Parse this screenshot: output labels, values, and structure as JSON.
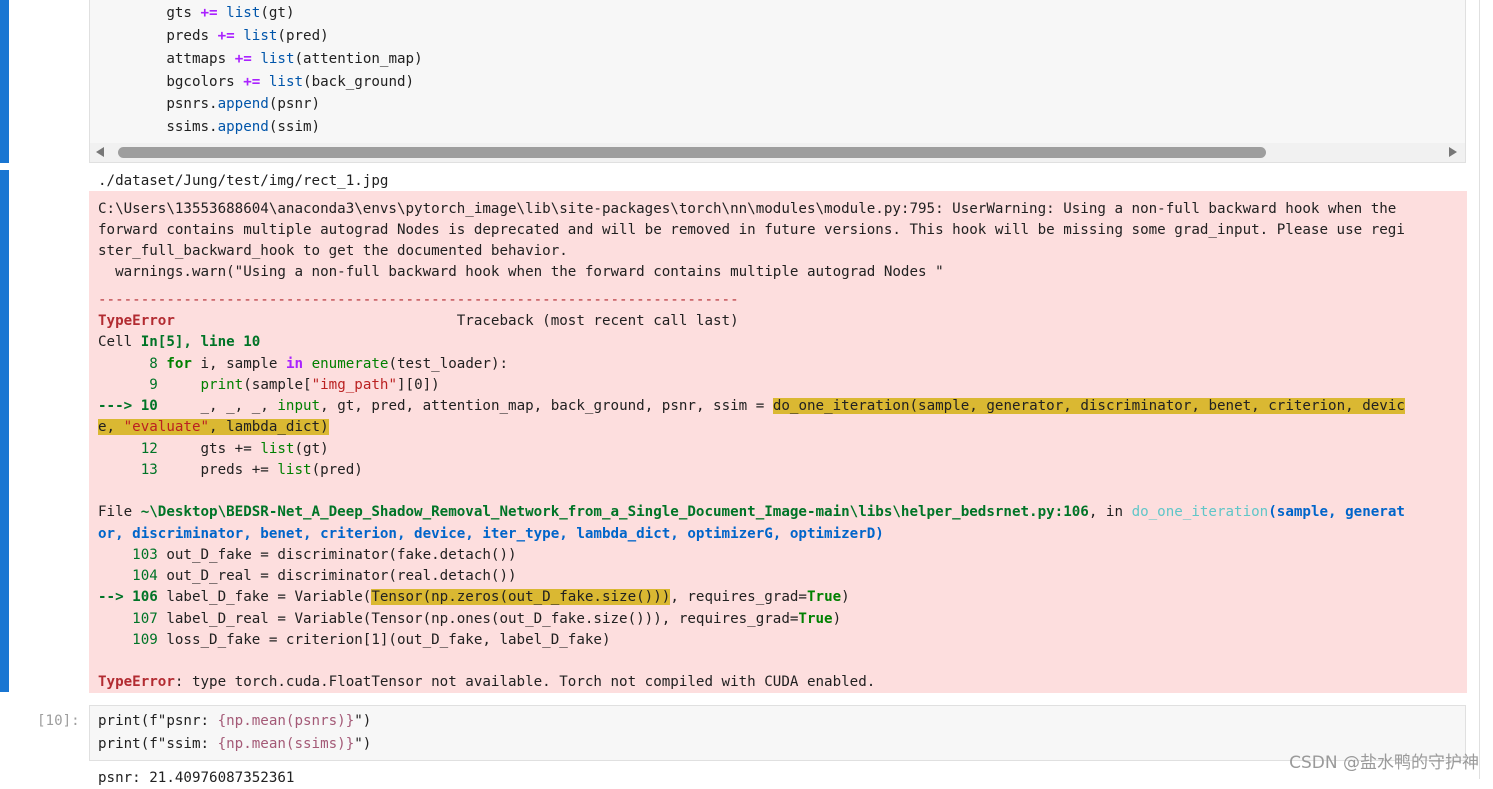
{
  "code_top": {
    "lines": [
      {
        "indent": "        ",
        "var": "gts",
        "op": "+=",
        "fn": "list",
        "arg": "(gt)"
      },
      {
        "indent": "        ",
        "var": "preds",
        "op": "+=",
        "fn": "list",
        "arg": "(pred)"
      },
      {
        "indent": "        ",
        "var": "attmaps",
        "op": "+=",
        "fn": "list",
        "arg": "(attention_map)"
      },
      {
        "indent": "        ",
        "var": "bgcolors",
        "op": "+=",
        "fn": "list",
        "arg": "(back_ground)"
      }
    ],
    "append_lines": [
      {
        "indent": "        ",
        "obj": "psnrs.",
        "fn": "append",
        "arg": "(psnr)"
      },
      {
        "indent": "        ",
        "obj": "ssims.",
        "fn": "append",
        "arg": "(ssim)"
      }
    ]
  },
  "output": {
    "path_line": "./dataset/Jung/test/img/rect_1.jpg",
    "warning": [
      "C:\\Users\\13553688604\\anaconda3\\envs\\pytorch_image\\lib\\site-packages\\torch\\nn\\modules\\module.py:795: UserWarning: Using a non-full backward hook when the",
      "forward contains multiple autograd Nodes is deprecated and will be removed in future versions. This hook will be missing some grad_input. Please use regi",
      "ster_full_backward_hook to get the documented behavior.",
      "  warnings.warn(\"Using a non-full backward hook when the forward contains multiple autograd Nodes \""
    ],
    "dashes": "---------------------------------------------------------------------------",
    "error_name": "TypeError",
    "traceback_title": "Traceback (most recent call last)",
    "cell_prefix": "Cell ",
    "cell_ref": "In[5], line 10",
    "tb1": {
      "l8_num": "      8 ",
      "l8_for": "for",
      "l8_a": " i, sample ",
      "l8_in": "in",
      "l8_sp": " ",
      "l8_enum": "enumerate",
      "l8_b": "(test_loader):",
      "l9_num": "      9 ",
      "l9_indent": "    ",
      "l9_print": "print",
      "l9_a": "(sample[",
      "l9_str": "\"img_path\"",
      "l9_b": "][0])",
      "l10_arrow": "---> 10 ",
      "l10_a": "    _, _, _, ",
      "l10_input": "input",
      "l10_b": ", gt, pred, attention_map, back_ground, psnr, ssim = ",
      "l10_hl": "do_one_iteration(sample, generator, discriminator, benet, criterion, devic",
      "l10c_a": "e, ",
      "l10c_str": "\"evaluate\"",
      "l10c_b": ", lambda_dict)",
      "l12_num": "     12 ",
      "l12_a": "    gts += ",
      "l12_list": "list",
      "l12_b": "(gt)",
      "l13_num": "     13 ",
      "l13_a": "    preds += ",
      "l13_list": "list",
      "l13_b": "(pred)"
    },
    "file_prefix": "File ",
    "file_path": "~\\Desktop\\BEDSR-Net_A_Deep_Shadow_Removal_Network_from_a_Single_Document_Image-main\\libs\\helper_bedsrnet.py:106",
    "file_in": ", in ",
    "file_func": "do_one_iteration",
    "file_args1": "(sample, generat",
    "file_args2": "or, discriminator, benet, criterion, device, iter_type, lambda_dict, optimizerG, optimizerD)",
    "tb2": {
      "l103_num": "    103 ",
      "l103": "out_D_fake = discriminator(fake.detach())",
      "l104_num": "    104 ",
      "l104": "out_D_real = discriminator(real.detach())",
      "l106_arrow": "--> 106 ",
      "l106_a": "label_D_fake = Variable(",
      "l106_hl": "Tensor(np.zeros(out_D_fake.size()))",
      "l106_b": ", requires_grad=",
      "l106_true": "True",
      "l106_c": ")",
      "l107_num": "    107 ",
      "l107_a": "label_D_real = Variable(Tensor(np.ones(out_D_fake.size())), requires_grad=",
      "l107_true": "True",
      "l107_b": ")",
      "l109_num": "    109 ",
      "l109": "loss_D_fake = criterion[1](out_D_fake, label_D_fake)"
    },
    "final_error_name": "TypeError",
    "final_error_msg": ": type torch.cuda.FloatTensor not available. Torch not compiled with CUDA enabled."
  },
  "cell2": {
    "prompt": "[10]:",
    "line1_a": "print(f\"psnr: ",
    "line1_b": "{np.mean(psnrs)}",
    "line1_c": "\")",
    "line2_a": "print(f\"ssim: ",
    "line2_b": "{np.mean(ssims)}",
    "line2_c": "\")",
    "output_partial": "psnr: 21.40976087352361"
  },
  "watermark": "CSDN @盐水鸭的守护神"
}
